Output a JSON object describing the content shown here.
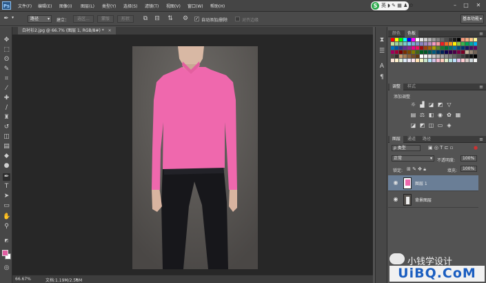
{
  "app": {
    "logo": "Ps"
  },
  "menu": [
    "文件(F)",
    "编辑(E)",
    "图像(I)",
    "图层(L)",
    "类型(Y)",
    "选择(S)",
    "滤镜(T)",
    "视图(V)",
    "窗口(W)",
    "帮助(H)"
  ],
  "window_controls": {
    "minimize": "–",
    "maximize": "□",
    "close": "✕"
  },
  "options": {
    "tool_mode": "路径",
    "make_label": "建立：",
    "selection_btn": "选区...",
    "mask_btn": "蒙版",
    "shape_btn": "形状",
    "auto_add_label": "自动添加/删除",
    "align_edges_label": "对齐边缘",
    "auto_add_checked": true,
    "workspace": "基本功能"
  },
  "document": {
    "tab": "白衬衫2.jpg @ 66.7% (图层 1, RGB/8#) *"
  },
  "status": {
    "zoom": "66.67%",
    "doc_info": "文档:1.19M/2.58M"
  },
  "panels": {
    "color_tab": "颜色",
    "swatches_tab": "色板",
    "adjustments_tab": "调整",
    "styles_tab": "样式",
    "add_adjustment": "添加调整",
    "layers_tab": "图层",
    "channels_tab": "通道",
    "paths_tab": "路径",
    "filter_kind": "ρ 类型",
    "blend_mode": "正常",
    "opacity_label": "不透明度:",
    "opacity_value": "100%",
    "lock_label": "锁定:",
    "fill_label": "填充:",
    "fill_value": "100%",
    "layers": [
      {
        "name": "图层 1",
        "selected": true
      },
      {
        "name": "背景图层",
        "selected": false
      }
    ]
  },
  "watermark": {
    "brand": "小钱学设计",
    "site": "UiBQ.CoM"
  },
  "colors": {
    "shirt": "#ef68ad",
    "foreground": "#e25ea2",
    "background": "#ffffff",
    "selected_layer": "#6a7e96"
  }
}
